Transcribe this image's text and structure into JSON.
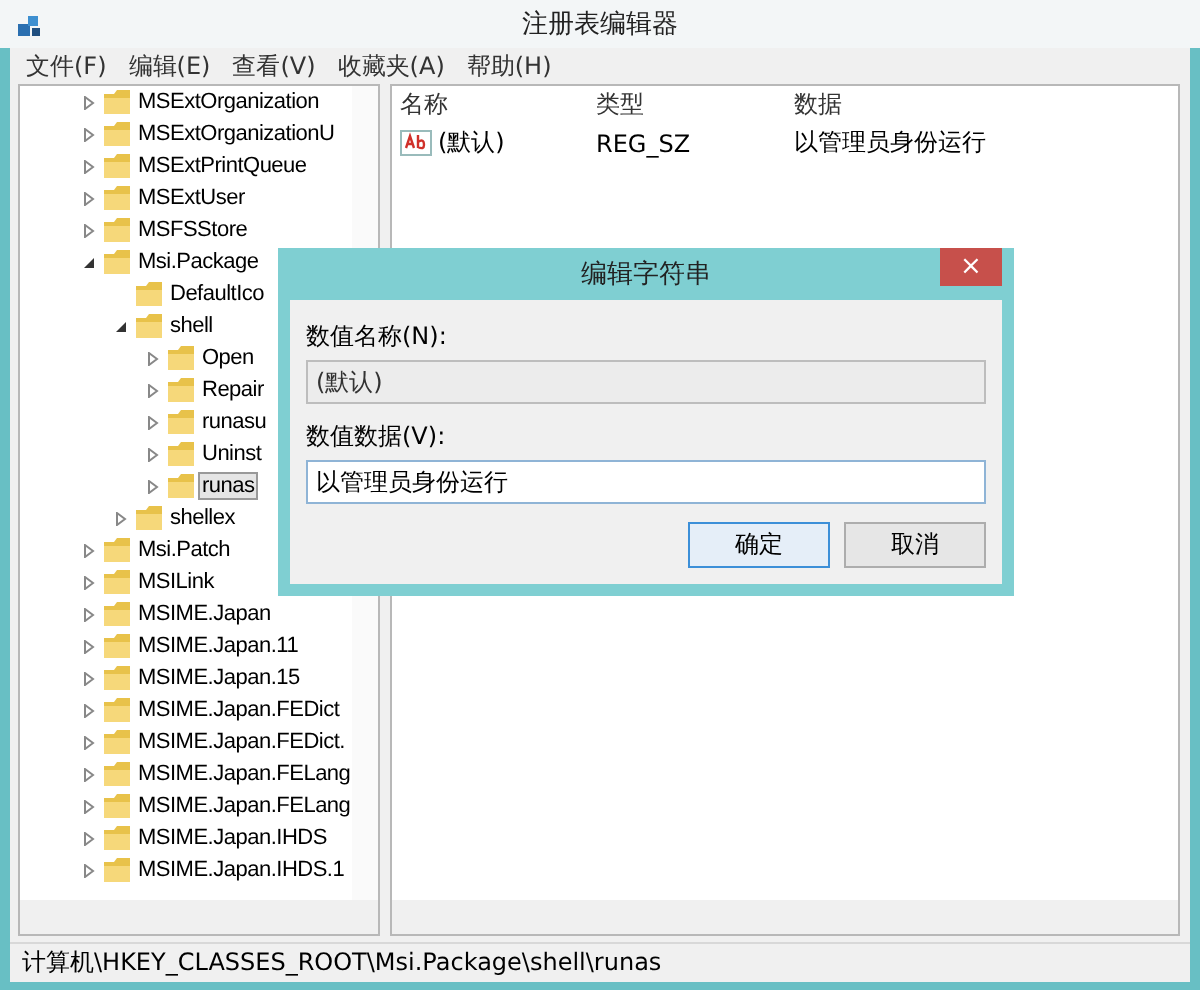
{
  "window": {
    "title": "注册表编辑器"
  },
  "menu": [
    {
      "label": "文件(F)"
    },
    {
      "label": "编辑(E)"
    },
    {
      "label": "查看(V)"
    },
    {
      "label": "收藏夹(A)"
    },
    {
      "label": "帮助(H)"
    }
  ],
  "tree": [
    {
      "label": "MSExtOrganization",
      "kind": "node",
      "expanded": false,
      "selected": false
    },
    {
      "label": "MSExtOrganizationU",
      "kind": "node",
      "expanded": false,
      "selected": false
    },
    {
      "label": "MSExtPrintQueue",
      "kind": "node",
      "expanded": false,
      "selected": false
    },
    {
      "label": "MSExtUser",
      "kind": "node",
      "expanded": false,
      "selected": false
    },
    {
      "label": "MSFSStore",
      "kind": "node",
      "expanded": false,
      "selected": false
    },
    {
      "label": "Msi.Package",
      "kind": "node",
      "expanded": true,
      "selected": false,
      "children": [
        {
          "label": "DefaultIco",
          "kind": "leaf",
          "selected": false
        },
        {
          "label": "shell",
          "kind": "node",
          "expanded": true,
          "selected": false,
          "children": [
            {
              "label": "Open",
              "kind": "node",
              "expanded": false,
              "selected": false
            },
            {
              "label": "Repair",
              "kind": "node",
              "expanded": false,
              "selected": false
            },
            {
              "label": "runasu",
              "kind": "node",
              "expanded": false,
              "selected": false
            },
            {
              "label": "Uninst",
              "kind": "node",
              "expanded": false,
              "selected": false
            },
            {
              "label": "runas",
              "kind": "node",
              "expanded": false,
              "selected": true
            }
          ]
        },
        {
          "label": "shellex",
          "kind": "node",
          "expanded": false,
          "selected": false
        }
      ]
    },
    {
      "label": "Msi.Patch",
      "kind": "node",
      "expanded": false,
      "selected": false
    },
    {
      "label": "MSILink",
      "kind": "node",
      "expanded": false,
      "selected": false
    },
    {
      "label": "MSIME.Japan",
      "kind": "node",
      "expanded": false,
      "selected": false
    },
    {
      "label": "MSIME.Japan.11",
      "kind": "node",
      "expanded": false,
      "selected": false
    },
    {
      "label": "MSIME.Japan.15",
      "kind": "node",
      "expanded": false,
      "selected": false
    },
    {
      "label": "MSIME.Japan.FEDict",
      "kind": "node",
      "expanded": false,
      "selected": false
    },
    {
      "label": "MSIME.Japan.FEDict.",
      "kind": "node",
      "expanded": false,
      "selected": false
    },
    {
      "label": "MSIME.Japan.FELang",
      "kind": "node",
      "expanded": false,
      "selected": false
    },
    {
      "label": "MSIME.Japan.FELang",
      "kind": "node",
      "expanded": false,
      "selected": false
    },
    {
      "label": "MSIME.Japan.IHDS",
      "kind": "node",
      "expanded": false,
      "selected": false
    },
    {
      "label": "MSIME.Japan.IHDS.1",
      "kind": "node",
      "expanded": false,
      "selected": false
    }
  ],
  "values": {
    "columns": [
      "名称",
      "类型",
      "数据"
    ],
    "rows": [
      {
        "name": "(默认)",
        "type": "REG_SZ",
        "data": "以管理员身份运行"
      }
    ]
  },
  "dialog": {
    "title": "编辑字符串",
    "close": "×",
    "name_label": "数值名称(N):",
    "name_value": "(默认)",
    "data_label": "数值数据(V):",
    "data_value": "以管理员身份运行",
    "buttons": [
      {
        "label": "确定",
        "selected": true
      },
      {
        "label": "取消",
        "selected": false
      }
    ]
  },
  "status_bar": "计算机\\HKEY_CLASSES_ROOT\\Msi.Package\\shell\\runas"
}
